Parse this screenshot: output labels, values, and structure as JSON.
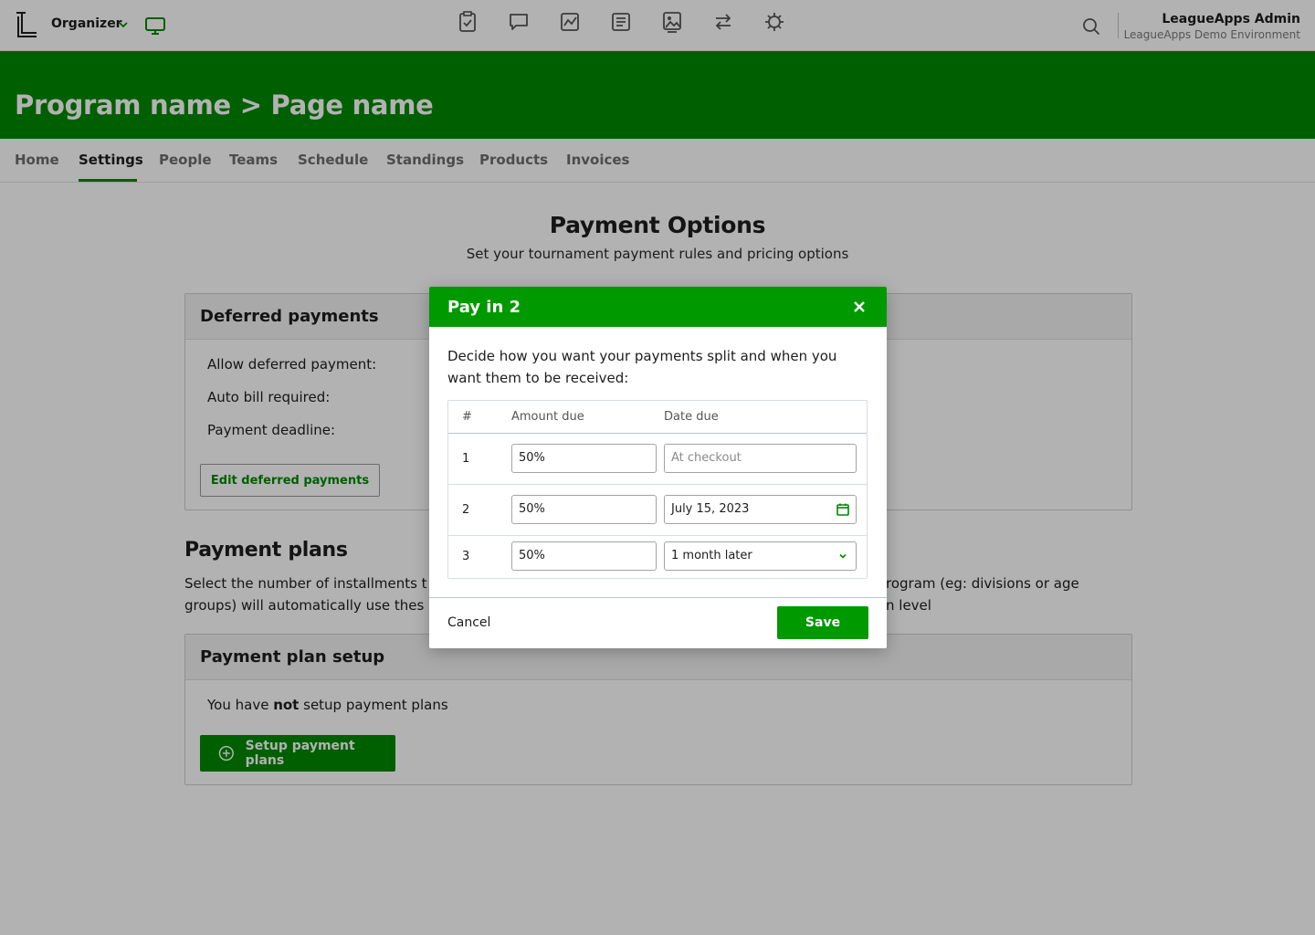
{
  "topbar": {
    "org_label": "Organizer",
    "admin_name": "LeagueApps Admin",
    "admin_env": "LeagueApps Demo Environment",
    "nav_icons": [
      "clipboard-check-icon",
      "chat-bubble-icon",
      "chart-icon",
      "document-icon",
      "image-icon",
      "transfer-arrows-icon",
      "gear-icon"
    ]
  },
  "banner": {
    "title": "Program name > Page name"
  },
  "tabs": [
    {
      "label": "Home"
    },
    {
      "label": "Settings"
    },
    {
      "label": "People"
    },
    {
      "label": "Teams"
    },
    {
      "label": "Schedule"
    },
    {
      "label": "Standings"
    },
    {
      "label": "Products"
    },
    {
      "label": "Invoices"
    }
  ],
  "active_tab": "Settings",
  "page": {
    "title": "Payment Options",
    "subtitle": "Set your tournament payment rules and pricing options"
  },
  "deferred": {
    "title": "Deferred payments",
    "rows": [
      "Allow deferred payment:",
      "Auto bill required:",
      "Payment deadline:"
    ],
    "edit_button": "Edit deferred payments"
  },
  "plans": {
    "title": "Payment plans",
    "description_left": "Select the number of installments t",
    "description_left2": "groups) will automatically use thes",
    "description_right": "rogram (eg: divisions or age",
    "description_right2": "n level"
  },
  "setup": {
    "title": "Payment plan setup",
    "text_before": "You have ",
    "text_bold": "not",
    "text_after": " setup payment plans",
    "button": "Setup payment plans"
  },
  "modal": {
    "title": "Pay in 2",
    "description": "Decide how you want your payments split and when you want them to be received:",
    "columns": {
      "num": "#",
      "amount": "Amount due",
      "date": "Date due"
    },
    "rows": [
      {
        "num": "1",
        "amount": "50%",
        "date": "At checkout",
        "date_type": "placeholder"
      },
      {
        "num": "2",
        "amount": "50%",
        "date": "July 15, 2023",
        "date_type": "date"
      },
      {
        "num": "3",
        "amount": "50%",
        "date": "1 month later",
        "date_type": "select"
      }
    ],
    "cancel": "Cancel",
    "save": "Save"
  },
  "colors": {
    "brand_green": "#008800",
    "modal_green": "#009900"
  }
}
